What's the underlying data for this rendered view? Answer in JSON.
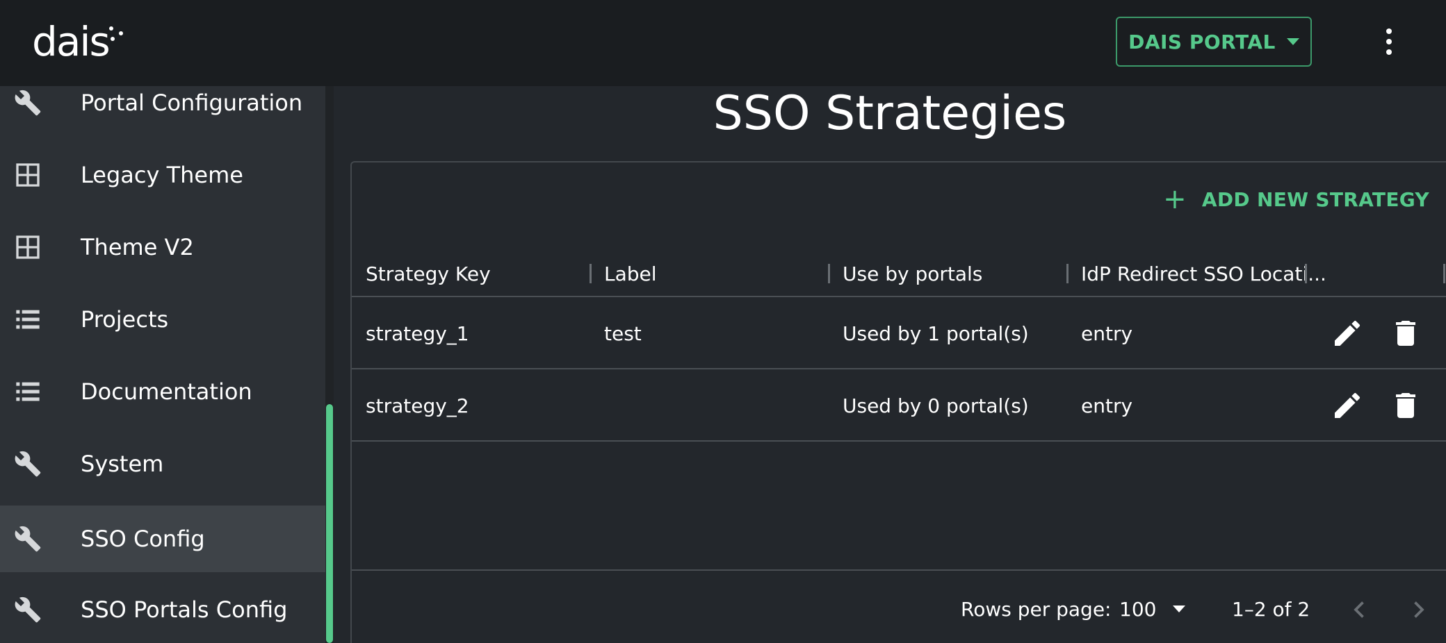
{
  "header": {
    "logo_text": "dais",
    "portal_button": "DAIS PORTAL"
  },
  "sidebar": {
    "items": [
      {
        "label": "Portal Configuration",
        "icon": "wrench-icon"
      },
      {
        "label": "Legacy Theme",
        "icon": "grid-icon"
      },
      {
        "label": "Theme V2",
        "icon": "grid-icon"
      },
      {
        "label": "Projects",
        "icon": "list-icon"
      },
      {
        "label": "Documentation",
        "icon": "list-icon"
      },
      {
        "label": "System",
        "icon": "wrench-icon"
      },
      {
        "label": "SSO Config",
        "icon": "wrench-icon",
        "active": true
      },
      {
        "label": "SSO Portals Config",
        "icon": "wrench-icon"
      }
    ]
  },
  "main": {
    "title": "SSO Strategies",
    "add_button": "ADD NEW STRATEGY",
    "columns": [
      "Strategy Key",
      "Label",
      "Use by portals",
      "IdP Redirect SSO Locati..."
    ],
    "rows": [
      {
        "key": "strategy_1",
        "label": "test",
        "portals": "Used by 1 portal(s)",
        "location": "entry"
      },
      {
        "key": "strategy_2",
        "label": "",
        "portals": "Used by 0 portal(s)",
        "location": "entry"
      }
    ],
    "pagination": {
      "rows_per_page_label": "Rows per page:",
      "rows_per_page_value": "100",
      "range": "1–2 of 2"
    }
  },
  "colors": {
    "accent": "#56c98b",
    "background": "#23272c",
    "sidebar": "#2c3035",
    "topbar": "#1a1d20"
  }
}
